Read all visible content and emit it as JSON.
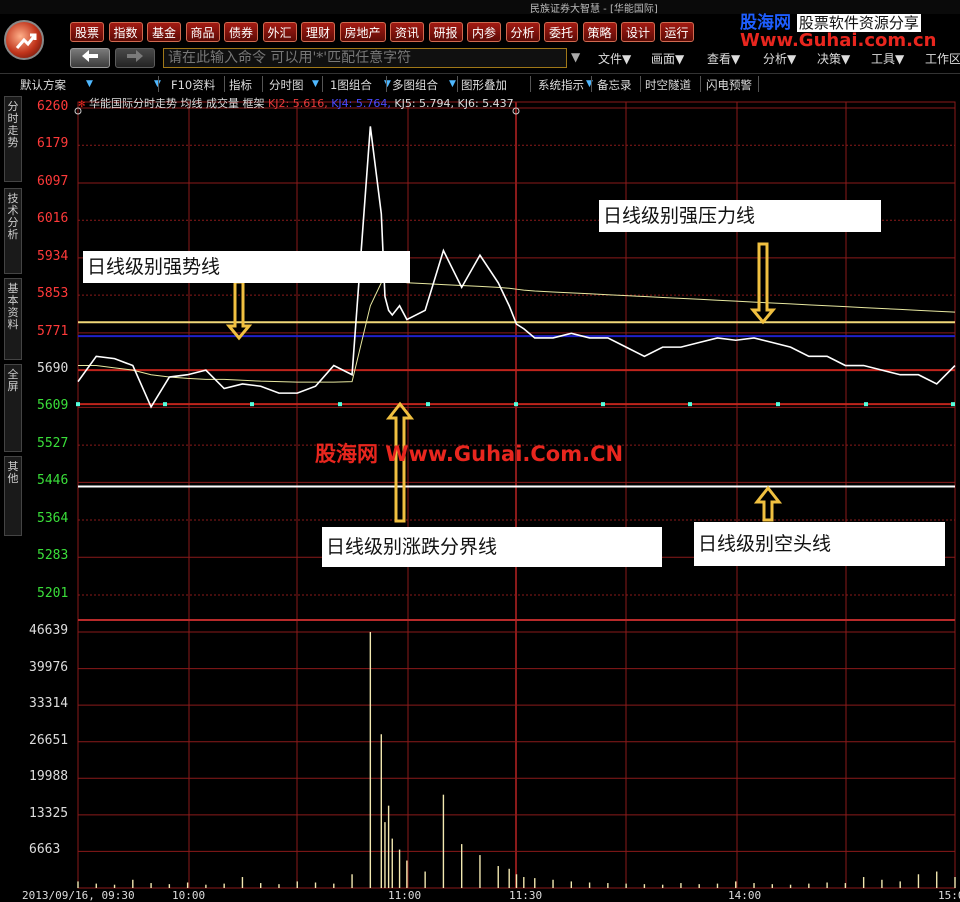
{
  "window": {
    "title": "民族证券大智慧 - [华能国际]"
  },
  "menu": [
    "股票",
    "指数",
    "基金",
    "商品",
    "债券",
    "外汇",
    "理财",
    "房地产",
    "资讯",
    "研报",
    "内参",
    "分析",
    "委托",
    "策略",
    "设计",
    "运行"
  ],
  "nav": {
    "back_icon": "arrow-left-icon",
    "forward_icon": "arrow-right-icon"
  },
  "command_input": {
    "placeholder": "请在此输入命令      可以用'*'匹配任意字符"
  },
  "dropdowns": [
    "文件▼",
    "画面▼",
    "查看▼",
    "分析▼",
    "决策▼",
    "工具▼",
    "工作区"
  ],
  "watermark_top": {
    "brand": "股海网",
    "tagline": "股票软件资源分享",
    "url": "Www.Guhai.com.cn"
  },
  "toolbar": [
    "默认方案",
    "F10资料",
    "指标",
    "分时图",
    "1图组合",
    "多图组合",
    "图形叠加",
    "系统指示",
    "备忘录",
    "时空隧道",
    "闪电预警"
  ],
  "side_tabs": [
    "分时走势",
    "技术分析",
    "基本资料",
    "全屏",
    "其他"
  ],
  "chart_header": {
    "stock": "华能国际分时走势",
    "items": [
      "均线",
      "成交量",
      "框架"
    ],
    "kj2": "KJ2: 5.616,",
    "kj4": "KJ4: 5.764,",
    "kj5": "KJ5: 5.794,",
    "kj6": "KJ6: 5.437"
  },
  "price_axis": [
    "6260",
    "6179",
    "6097",
    "6016",
    "5934",
    "5853",
    "5771",
    "5690",
    "5609",
    "5527",
    "5446",
    "5364",
    "5283",
    "5201"
  ],
  "volume_axis": [
    "46639",
    "39976",
    "33314",
    "26651",
    "19988",
    "13325",
    "6663"
  ],
  "time_axis": [
    "2013/09/16, 09:30",
    "10:00",
    "11:00",
    "11:30",
    "14:00",
    "15:0"
  ],
  "annotations": {
    "strong_trend": "日线级别强势线",
    "strong_pressure": "日线级别强压力线",
    "divide_line": "日线级别涨跌分界线",
    "bear_line": "日线级别空头线"
  },
  "watermark_center": "股海网 Www.Guhai.Com.CN",
  "colors": {
    "accent": "#c0241c",
    "grid": "#8a1a1a",
    "price_line": "#ffffff",
    "avg_line": "#e8e8a0",
    "kj_yellow": "#f0d878",
    "kj_blue": "#2020c8",
    "arrow": "#f0c040"
  },
  "chart_data": {
    "type": "line",
    "title": "华能国际分时走势",
    "xlabel": "",
    "ylabel": "",
    "ylim": [
      5201,
      6260
    ],
    "vol_lim": [
      0,
      46639
    ],
    "horizontal_lines": [
      {
        "value": 5794,
        "color": "#f0d878"
      },
      {
        "value": 5764,
        "color": "#2020c8"
      },
      {
        "value": 5690,
        "color": "#c0241c"
      },
      {
        "value": 5616,
        "color": "#c0241c"
      },
      {
        "value": 5437,
        "color": "#ffffff"
      }
    ],
    "x": [
      0,
      5,
      10,
      15,
      20,
      25,
      30,
      35,
      40,
      45,
      50,
      55,
      60,
      65,
      70,
      75,
      80,
      83,
      84,
      85,
      86,
      88,
      90,
      95,
      100,
      105,
      110,
      115,
      118,
      120,
      122,
      125,
      130,
      135,
      140,
      145,
      150,
      155,
      160,
      165,
      170,
      175,
      180,
      185,
      190,
      195,
      200,
      205,
      210,
      215,
      220,
      225,
      230,
      235,
      240
    ],
    "series": [
      {
        "values": [
          5665,
          5720,
          5715,
          5700,
          5610,
          5675,
          5680,
          5690,
          5650,
          5660,
          5655,
          5640,
          5640,
          5655,
          5700,
          5680,
          6220,
          6030,
          5850,
          5820,
          5810,
          5830,
          5800,
          5820,
          5950,
          5870,
          5940,
          5880,
          5830,
          5790,
          5780,
          5760,
          5760,
          5770,
          5760,
          5760,
          5740,
          5720,
          5740,
          5740,
          5750,
          5760,
          5755,
          5760,
          5750,
          5740,
          5720,
          5720,
          5700,
          5700,
          5690,
          5680,
          5680,
          5660,
          5700
        ]
      },
      {
        "values": [
          5700,
          5700,
          5695,
          5690,
          5680,
          5675,
          5672,
          5670,
          5670,
          5668,
          5666,
          5665,
          5664,
          5664,
          5664,
          5665,
          5830,
          5880,
          5890,
          5890,
          5885,
          5883,
          5880,
          5878,
          5876,
          5874,
          5872,
          5870,
          5868,
          5866,
          5864,
          5862,
          5860,
          5858,
          5856,
          5854,
          5852,
          5850,
          5848,
          5846,
          5844,
          5842,
          5840,
          5838,
          5836,
          5834,
          5832,
          5830,
          5828,
          5826,
          5824,
          5822,
          5820,
          5818,
          5816
        ]
      }
    ],
    "volume": [
      1200,
      800,
      600,
      1500,
      900,
      700,
      1000,
      600,
      800,
      2000,
      900,
      700,
      1200,
      1000,
      800,
      2500,
      46639,
      28000,
      12000,
      15000,
      9000,
      7000,
      5000,
      3000,
      17000,
      8000,
      6000,
      4000,
      3500,
      2500,
      2000,
      1800,
      1500,
      1200,
      1000,
      900,
      800,
      700,
      600,
      900,
      700,
      800,
      1200,
      900,
      700,
      600,
      800,
      1000,
      900,
      2000,
      1500,
      1200,
      2500,
      3000,
      2000
    ]
  }
}
